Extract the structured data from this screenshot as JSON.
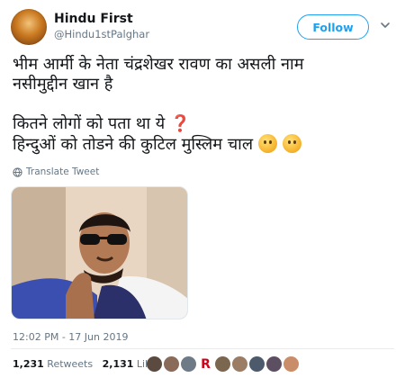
{
  "author": {
    "name": "Hindu First",
    "handle": "@Hindu1stPalghar",
    "avatar_icon": "avatar-icon"
  },
  "follow_label": "Follow",
  "tweet": {
    "lines": [
      "भीम आर्मी के नेता चंद्रशेखर रावण का असली नाम",
      "नसीमुद्दीन खान है",
      "",
      "कितने लोगों को पता था ये",
      "हिन्दुओं को तोडने की कुटिल मुस्लिम चाल"
    ],
    "question_emoji": "❓",
    "thinking_emoji_icon": "thinking-face-icon"
  },
  "translate_label": "Translate Tweet",
  "timestamp": "12:02 PM - 17 Jun 2019",
  "stats": {
    "retweets_count": "1,231",
    "retweets_label": "Retweets",
    "likes_count": "2,131",
    "likes_label": "Likes"
  },
  "likers_letter_avatar": "R",
  "colors": {
    "accent": "#1da1f2",
    "secondary_text": "#657786",
    "divider": "#e6ecf0"
  }
}
